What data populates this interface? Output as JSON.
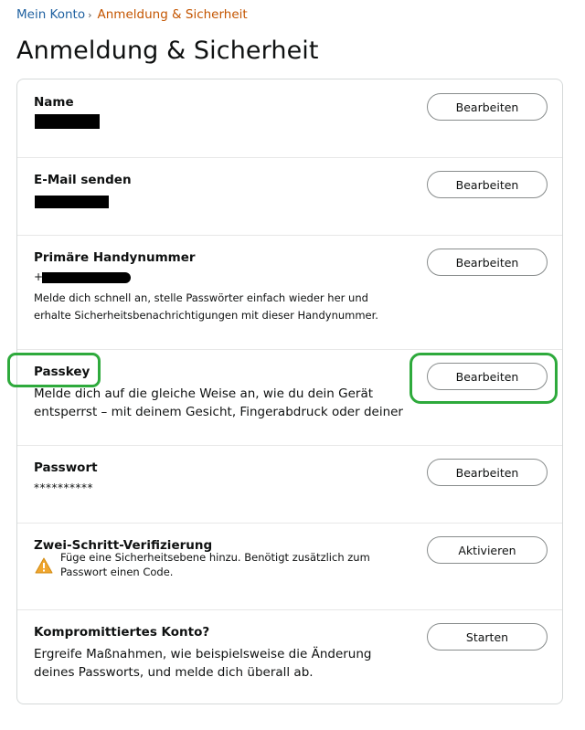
{
  "breadcrumb": {
    "parent": "Mein Konto",
    "separator": "›",
    "current": "Anmeldung & Sicherheit"
  },
  "page_title": "Anmeldung & Sicherheit",
  "rows": {
    "name": {
      "title": "Name",
      "button": "Bearbeiten"
    },
    "email": {
      "title": "E-Mail senden",
      "button": "Bearbeiten"
    },
    "phone": {
      "title": "Primäre Handynummer",
      "prefix": "+",
      "desc": "Melde dich schnell an, stelle Passwörter einfach wieder her und erhalte Sicherheitsbenachrichtigungen mit dieser Handynummer.",
      "button": "Bearbeiten"
    },
    "passkey": {
      "title": "Passkey",
      "desc": "Melde dich auf die gleiche Weise an, wie du dein Gerät entsperrst – mit deinem Gesicht, Fingerabdruck oder deiner PIN.",
      "button": "Bearbeiten"
    },
    "password": {
      "title": "Passwort",
      "masked": "**********",
      "button": "Bearbeiten"
    },
    "two_step": {
      "title": "Zwei-Schritt-Verifizierung",
      "desc": "Füge eine Sicherheitsebene hinzu. Benötigt zusätzlich zum Passwort einen Code.",
      "icon": "warning-icon",
      "button": "Aktivieren"
    },
    "compromised": {
      "title": "Kompromittiertes Konto?",
      "desc": "Ergreife Maßnahmen, wie beispielsweise die Änderung deines Passworts, und melde dich überall ab.",
      "button": "Starten"
    }
  },
  "colors": {
    "link": "#2162a1",
    "breadcrumb_current": "#c45500",
    "highlight": "#2eaa3c",
    "warning": "#f0a62f"
  }
}
